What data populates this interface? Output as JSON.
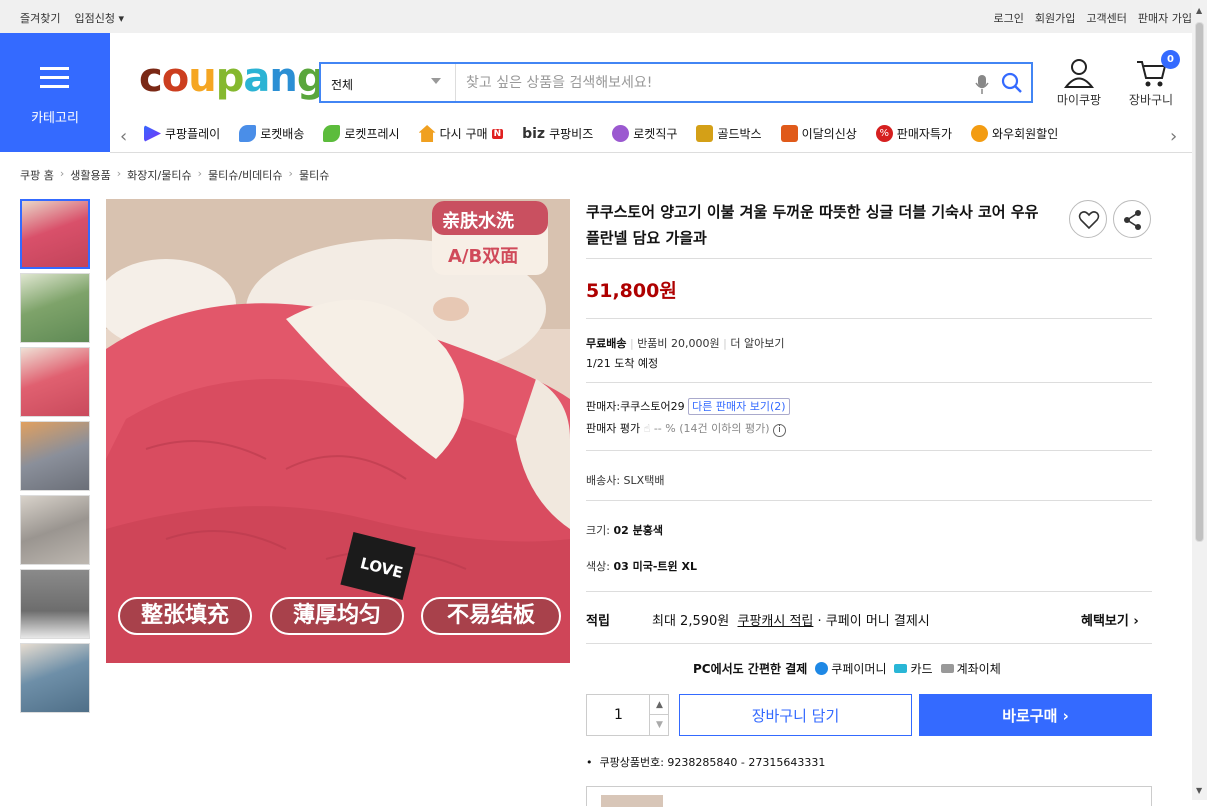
{
  "topbar": {
    "left": [
      "즐겨찾기",
      "입점신청 ▾"
    ],
    "right": [
      "로그인",
      "회원가입",
      "고객센터",
      "판매자 가입"
    ]
  },
  "category": {
    "label": "카테고리"
  },
  "logo": {
    "letters": [
      "c",
      "o",
      "u",
      "p",
      "a",
      "n",
      "g"
    ],
    "colors": [
      "#7a2815",
      "#cc3e1f",
      "#f5a623",
      "#85b82f",
      "#2bb3d4",
      "#2b8fd4",
      "#5aa63c"
    ]
  },
  "search": {
    "scope": "전체",
    "placeholder": "찾고 싶은 상품을 검색해보세요!"
  },
  "header_icons": {
    "mypage": "마이쿠팡",
    "cart": "장바구니",
    "cart_count": "0"
  },
  "nav": [
    {
      "label": "쿠팡플레이",
      "color": "#346aff"
    },
    {
      "label": "로켓배송",
      "color": "#4a8ee8"
    },
    {
      "label": "로켓프레시",
      "color": "#5cbc3c"
    },
    {
      "label": "다시 구매",
      "color": "#f0a020"
    },
    {
      "label": "쿠팡비즈",
      "color": "#ffffff"
    },
    {
      "label": "로켓직구",
      "color": "#9b59d0"
    },
    {
      "label": "골드박스",
      "color": "#d4a017"
    },
    {
      "label": "이달의신상",
      "color": "#e05a1a"
    },
    {
      "label": "판매자특가",
      "color": "#d62020"
    },
    {
      "label": "와우회원할인",
      "color": "#f39c12"
    }
  ],
  "nav_extra": {
    "badge_n": "N",
    "biz": "biz"
  },
  "breadcrumb": [
    "쿠팡 홈",
    "생활용품",
    "화장지/물티슈",
    "물티슈/비데티슈",
    "물티슈"
  ],
  "image_text": {
    "top1": "亲肤水洗",
    "top2": "A/B双面",
    "tag": "LOVE",
    "b1": "整张填充",
    "b2": "薄厚均匀",
    "b3": "不易结板"
  },
  "product": {
    "title": "쿠쿠스토어 양고기 이불 겨울 두꺼운 따뜻한 싱글 더블 기숙사 코어 우유 플란넬 담요 가을과",
    "price": "51,800원",
    "shipping": "무료배송",
    "return_fee": "반품비 20,000원",
    "more": "더 알아보기",
    "arrival": "1/21 도착 예정",
    "seller": "판매자:쿠쿠스토어29",
    "other_sellers": "다른 판매자 보기(2)",
    "seller_rating_label": "판매자 평가",
    "seller_rating": "-- % (14건 이하의 평가)",
    "courier": "배송사:  SLX택배",
    "size_label": "크기:",
    "size_value": "02 분홍색",
    "color_label": "색상:",
    "color_value": "03 미국-트윈 XL",
    "reward_label": "적립",
    "reward_text": "최대 2,590원",
    "reward_link": "쿠팡캐시 적립",
    "reward_tail": "· 쿠페이 머니 결제시",
    "benefit": "혜택보기 ›",
    "pay_title": "PC에서도 간편한 결제",
    "pay_opts": [
      "쿠페이머니",
      "카드",
      "계좌이체"
    ],
    "qty": "1",
    "add_cart": "장바구니 담기",
    "buy_now": "바로구매 ›",
    "product_id": "쿠팡상품번호: 9238285840 - 27315643331"
  }
}
